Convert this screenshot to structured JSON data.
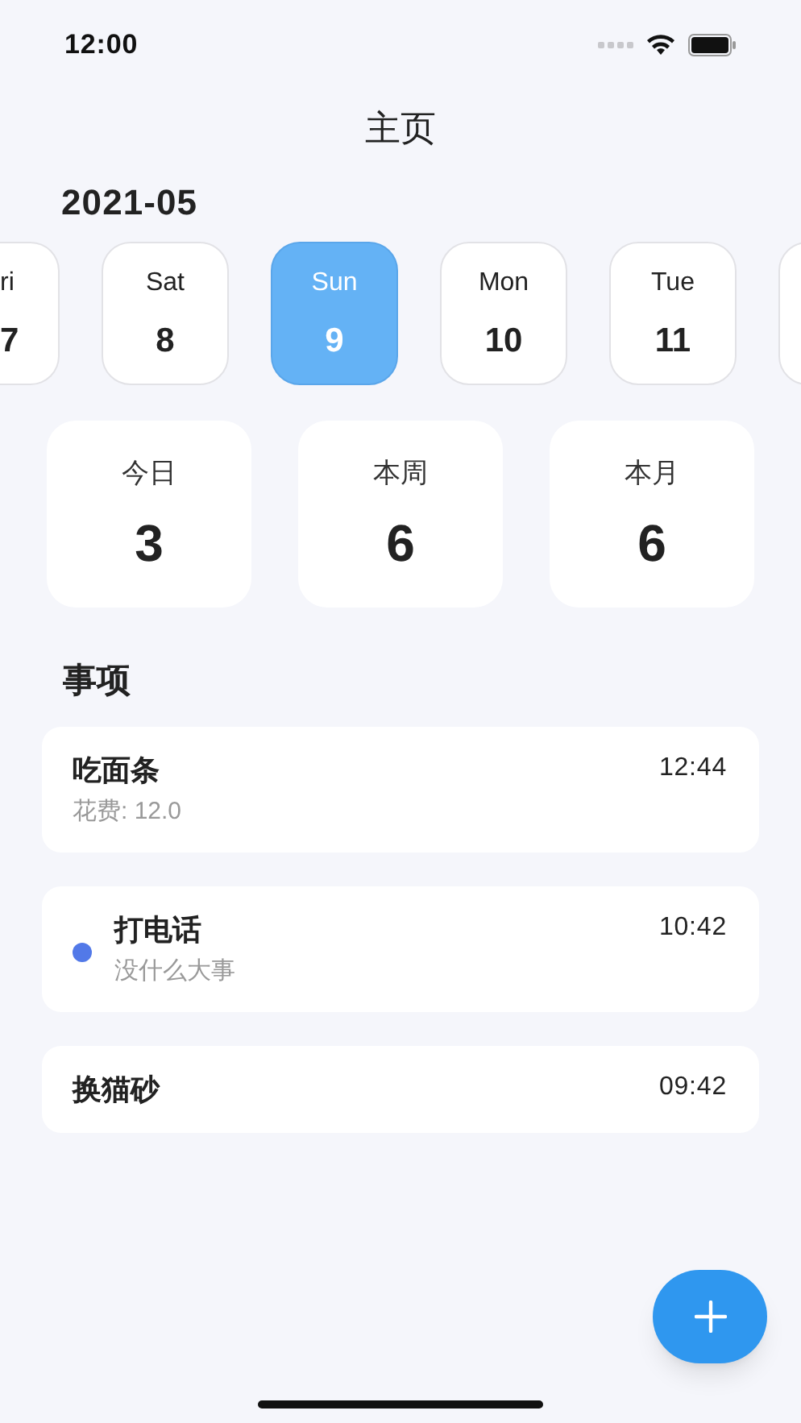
{
  "status_bar": {
    "time": "12:00"
  },
  "title": "主页",
  "month": "2021-05",
  "days": [
    {
      "kind": "partial",
      "weekday": "ri",
      "date": "7",
      "selected": false
    },
    {
      "kind": "full",
      "weekday": "Sat",
      "date": "8",
      "selected": false
    },
    {
      "kind": "full",
      "weekday": "Sun",
      "date": "9",
      "selected": true
    },
    {
      "kind": "full",
      "weekday": "Mon",
      "date": "10",
      "selected": false
    },
    {
      "kind": "full",
      "weekday": "Tue",
      "date": "11",
      "selected": false
    }
  ],
  "stats": [
    {
      "label": "今日",
      "value": "3"
    },
    {
      "label": "本周",
      "value": "6"
    },
    {
      "label": "本月",
      "value": "6"
    }
  ],
  "section_title": "事项",
  "items": [
    {
      "title": "吃面条",
      "note": "花费: 12.0",
      "time": "12:44"
    },
    {
      "title": "打电话",
      "note": "没什么大事",
      "time": "10:42",
      "color": "#5279e8"
    },
    {
      "title": "换猫砂",
      "time": "09:42"
    }
  ]
}
